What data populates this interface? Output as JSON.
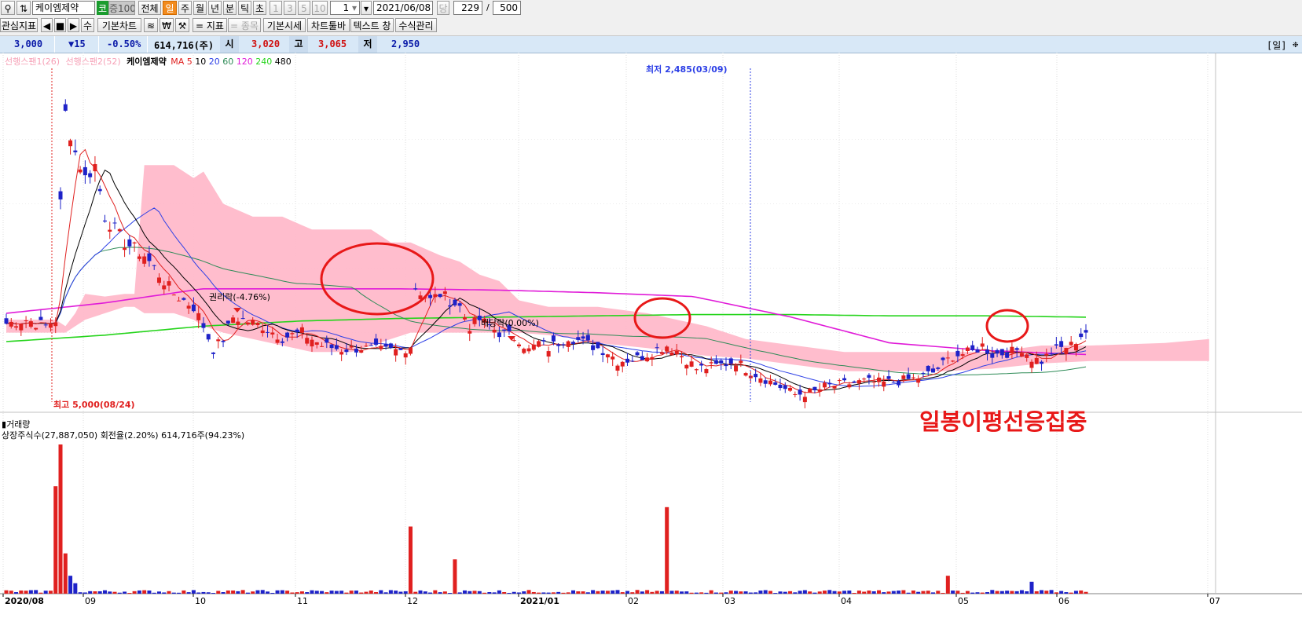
{
  "toolbar": {
    "stock_name": "케이엠제약",
    "market_badge": "코",
    "margin_badge": "증100",
    "period_all": "전체",
    "period_day": "일",
    "period_week": "주",
    "period_month": "월",
    "period_year": "년",
    "period_minute": "분",
    "period_tick": "틱",
    "period_second": "초",
    "interval_1": "1",
    "interval_3": "3",
    "interval_5": "5",
    "interval_10": "10",
    "interval_value": "1",
    "date": "2021/06/08",
    "per_label": "당",
    "count": "229",
    "slash": "/",
    "total": "500",
    "favorite_indicator": "관심지표",
    "order_button": "수",
    "basic_chart": "기본차트",
    "indicator_button": "= 지표",
    "item_button": "= 종목",
    "basic_quote": "기본시세",
    "chart_toolbar": "차트툴바",
    "text_window": "텍스트 창",
    "formula_manager": "수식관리"
  },
  "quote": {
    "price": "3,000",
    "change": "▼15",
    "change_pct": "-0.50%",
    "volume": "614,716(주)",
    "open_label": "시",
    "open": "3,020",
    "high_label": "고",
    "high": "3,065",
    "low_label": "저",
    "low": "2,950",
    "period_tag": "[일]"
  },
  "legend": {
    "span1": "선행스팬1(26)",
    "span2": "선행스팬2(52)",
    "stock": "케이엠제약",
    "ma_label": "MA",
    "ma_periods": [
      "5",
      "10",
      "20",
      "60",
      "120",
      "240",
      "480"
    ]
  },
  "volume_panel": {
    "title": "거래량",
    "listed_label": "상장주식수",
    "listed_value": "(27,887,050)",
    "turnover_label": "회전율(2.20%)",
    "volume_value": "614,716주(94.23%)"
  },
  "colors": {
    "up": "#e0201f",
    "down": "#1e22c8",
    "ma5": "#e0201f",
    "ma10": "#000000",
    "ma20": "#2c3fe6",
    "ma60": "#2e8b57",
    "ma120": "#e01bd8",
    "ma240": "#25d41b",
    "cloud": "#ffb6c8",
    "annotation": "#e81818",
    "axis_text": "#000000",
    "info_bg": "#d8e8f7"
  },
  "chart_data": {
    "type": "candlestick",
    "overlays": [
      "MA5",
      "MA10",
      "MA20",
      "MA60",
      "MA120",
      "MA240",
      "Ichimoku cloud"
    ],
    "x_ticks": [
      "2020/08",
      "09",
      "10",
      "11",
      "12",
      "2021/01",
      "02",
      "03",
      "04",
      "05",
      "06",
      "07"
    ],
    "price_range": [
      2400,
      5100
    ],
    "annotations": {
      "high": "최고 5,000(08/24)",
      "low": "최저 2,485(03/09)",
      "rights_drop": "권리락(-4.76%)",
      "dividend_drop": "배당락(0.00%)",
      "note": "일봉이평선응집중"
    },
    "last_candle": {
      "date": "2021/06/08",
      "open": 3020,
      "high": 3065,
      "low": 2950,
      "close": 3000,
      "volume": 614716
    },
    "series": [
      {
        "name": "MA120",
        "approx_values": [
          3150,
          3230,
          3340,
          3340,
          3340,
          3330,
          3310,
          3280,
          3120,
          2920,
          2860,
          2830
        ]
      },
      {
        "name": "MA240",
        "approx_values": [
          2930,
          2980,
          3050,
          3090,
          3110,
          3120,
          3130,
          3140,
          3140,
          3130,
          3130,
          3120
        ]
      }
    ]
  }
}
